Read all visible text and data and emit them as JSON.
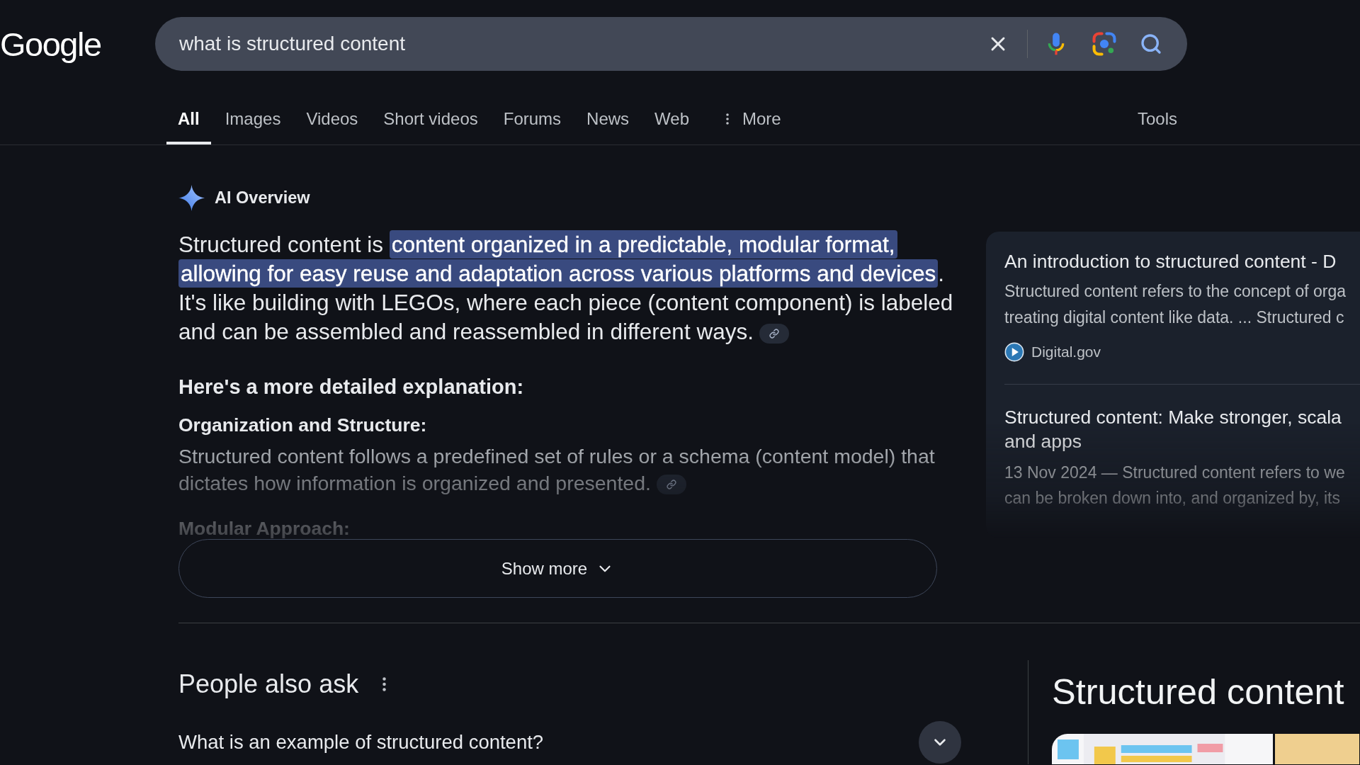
{
  "logo": {
    "text": "Google"
  },
  "search": {
    "value": "what is structured content"
  },
  "tabs": [
    {
      "label": "All",
      "selected": true,
      "kind": "plain"
    },
    {
      "label": "Images",
      "selected": false,
      "kind": "plain"
    },
    {
      "label": "Videos",
      "selected": false,
      "kind": "plain"
    },
    {
      "label": "Short videos",
      "selected": false,
      "kind": "plain"
    },
    {
      "label": "Forums",
      "selected": false,
      "kind": "plain"
    },
    {
      "label": "News",
      "selected": false,
      "kind": "plain"
    },
    {
      "label": "Web",
      "selected": false,
      "kind": "plain"
    },
    {
      "label": "More",
      "selected": false,
      "kind": "menu"
    }
  ],
  "tools": {
    "label": "Tools"
  },
  "ai_overview": {
    "title": "AI Overview",
    "summary": [
      {
        "text": "Structured content is ",
        "highlighted": false
      },
      {
        "text": "content organized in a predictable, modular format, allowing for easy reuse and adaptation across various platforms and devices",
        "highlighted": true
      },
      {
        "text": ". It's like building with LEGOs, where each piece (content component) is labeled and can be assembled and reassembled in different ways.",
        "highlighted": false
      }
    ],
    "heading": "Here's a more detailed explanation:",
    "points": [
      {
        "title": "Organization and Structure:",
        "text": "Structured content follows a predefined set of rules or a schema (content model) that dictates how information is organized and presented."
      },
      {
        "title": "Modular Approach:"
      }
    ],
    "show_more": {
      "label": "Show more"
    }
  },
  "sources": [
    {
      "title_lines": [
        "An introduction to structured content - D"
      ],
      "snippet_lines": [
        "Structured content refers to the concept of orga",
        "treating digital content like data. ... Structured c"
      ],
      "site": "Digital.gov"
    },
    {
      "title_lines": [
        "Structured content: Make stronger, scala",
        "and apps"
      ],
      "snippet_lines": [
        "13 Nov 2024 — Structured content refers to we",
        "can be broken down into, and organized by, its"
      ]
    }
  ],
  "people_also_ask": {
    "title": "People also ask",
    "questions": [
      {
        "text": "What is an example of structured content?",
        "expanded": false
      }
    ]
  },
  "knowledge_panel": {
    "title": "Structured content"
  }
}
